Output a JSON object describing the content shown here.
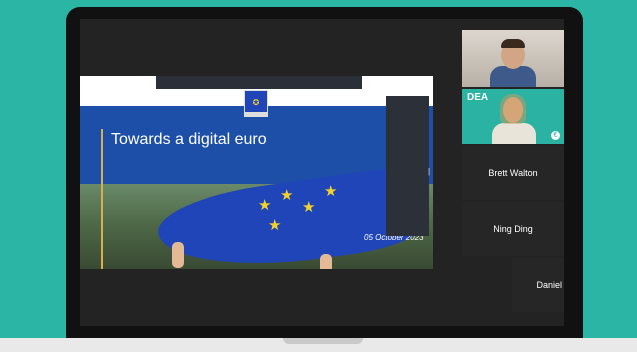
{
  "slide": {
    "title": "Towards a digital euro",
    "date": "05 October 2023",
    "logo_icon": "eu-flag-logo",
    "colors": {
      "blue": "#1d4fa8",
      "gold": "#d8b04a",
      "flag": "#1f45b8",
      "star": "#f6d12a"
    }
  },
  "participants": [
    {
      "name": "",
      "video": true
    },
    {
      "name": "",
      "video": true,
      "watermark": "DEA"
    },
    {
      "name": "Brett Walton",
      "video": false
    },
    {
      "name": "Ning Ding",
      "video": false
    },
    {
      "name": "Daniel",
      "video": false
    }
  ],
  "background_color": "#2bb5a4"
}
